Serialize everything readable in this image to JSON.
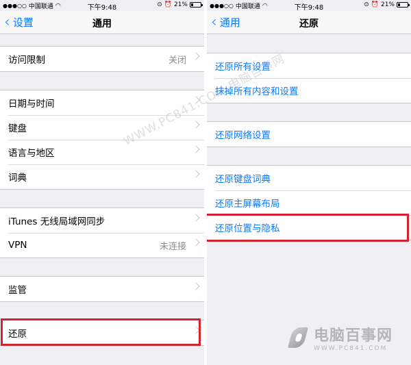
{
  "status": {
    "carrier": "中国联通",
    "time": "下午9:48",
    "battery": "21%",
    "battery_level": 0.21
  },
  "left": {
    "back_label": "设置",
    "title": "通用",
    "groups": [
      [
        {
          "label": "访问限制",
          "value": "关闭"
        }
      ],
      [
        {
          "label": "日期与时间"
        },
        {
          "label": "键盘"
        },
        {
          "label": "语言与地区"
        },
        {
          "label": "词典"
        }
      ],
      [
        {
          "label": "iTunes 无线局域网同步"
        },
        {
          "label": "VPN",
          "value": "未连接"
        }
      ],
      [
        {
          "label": "监管"
        }
      ],
      [
        {
          "label": "还原"
        }
      ]
    ]
  },
  "right": {
    "back_label": "通用",
    "title": "还原",
    "groups": [
      [
        {
          "label": "还原所有设置"
        },
        {
          "label": "抹掉所有内容和设置"
        }
      ],
      [
        {
          "label": "还原网络设置"
        }
      ],
      [
        {
          "label": "还原键盘词典"
        },
        {
          "label": "还原主屏幕布局"
        },
        {
          "label": "还原位置与隐私"
        }
      ]
    ]
  },
  "watermark": "WWW.PC841.COM 电脑百事网",
  "logo": {
    "name": "电脑百事网",
    "url": "WWW.PC841.COM"
  },
  "colors": {
    "accent": "#0a7aff",
    "highlight": "#d5222c",
    "background": "#efeff4"
  }
}
